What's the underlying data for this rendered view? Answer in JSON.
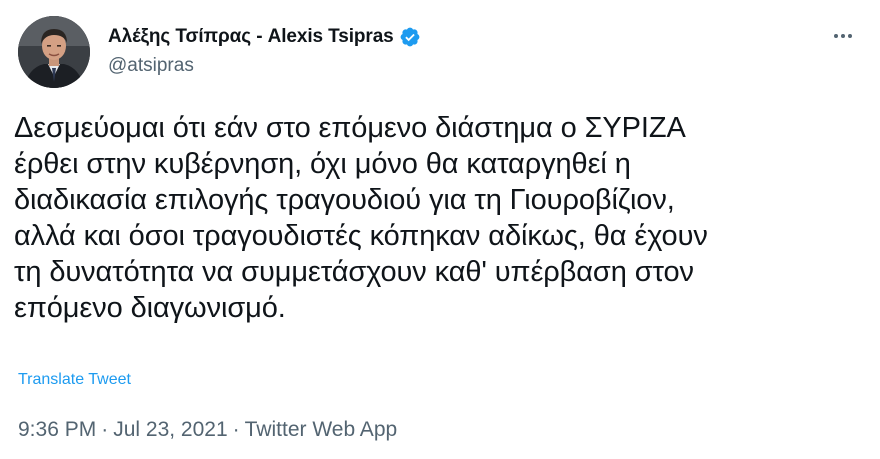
{
  "author": {
    "display_name": "Αλέξης Τσίπρας - Alexis Tsipras",
    "handle": "@atsipras",
    "verified": true
  },
  "tweet": {
    "text": "Δεσμεύομαι ότι εάν στο επόμενο διάστημα ο ΣΥΡΙΖΑ\nέρθει στην κυβέρνηση, όχι μόνο θα καταργηθεί η\nδιαδικασία επιλογής τραγουδιού για τη Γιουροβίζιον,\nαλλά και όσοι τραγουδιστές κόπηκαν αδίκως, θα έχουν\nτη δυνατότητα να συμμετάσχουν καθ' υπέρβαση στον\nεπόμενο διαγωνισμό.",
    "translate_label": "Translate Tweet"
  },
  "meta": {
    "time": "9:36 PM",
    "separator": "·",
    "date": "Jul 23, 2021",
    "source": "Twitter Web App"
  },
  "icons": {
    "verified": "verified-badge-icon",
    "more": "more-options-icon"
  },
  "colors": {
    "text": "#0f1419",
    "secondary": "#536471",
    "link": "#1d9bf0",
    "verified": "#1d9bf0"
  }
}
